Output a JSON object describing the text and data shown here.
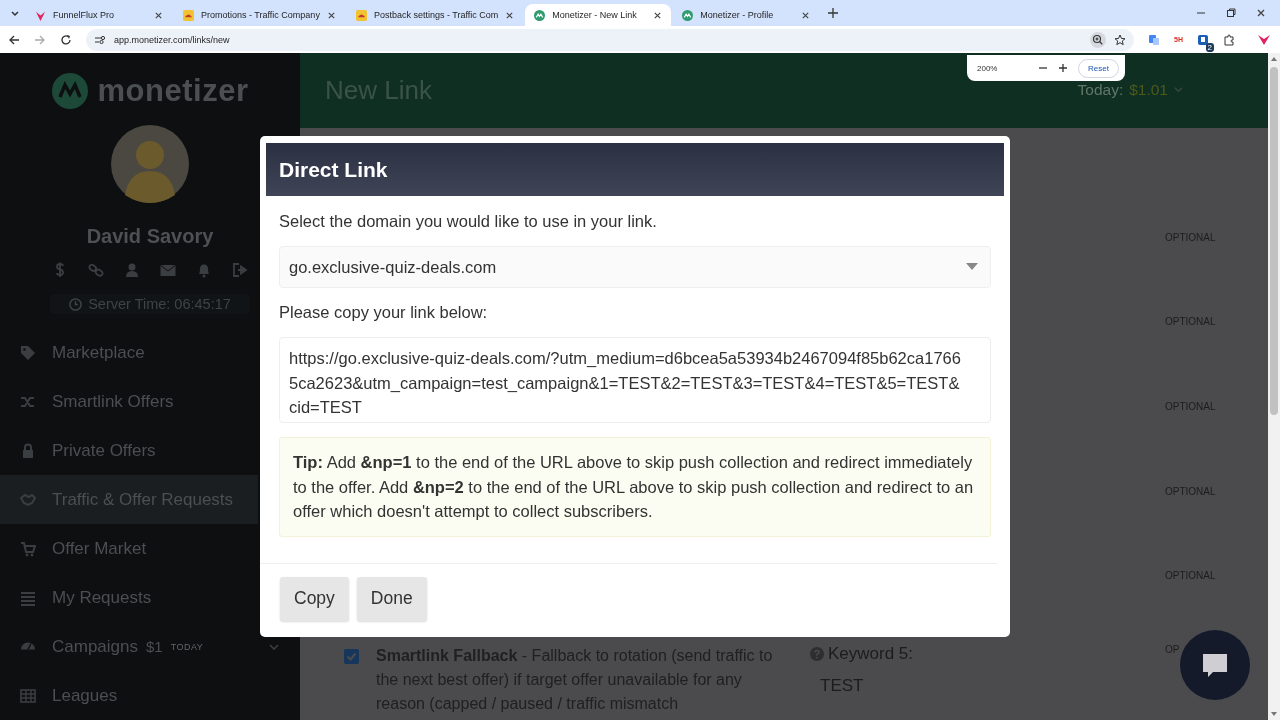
{
  "browser": {
    "tabs": [
      {
        "title": "FunnelFlux Pro",
        "selected": false
      },
      {
        "title": "Promotions - Traffic Company",
        "selected": false
      },
      {
        "title": "Postback settings - Traffic Com",
        "selected": false
      },
      {
        "title": "Monetizer - New Link",
        "selected": true
      },
      {
        "title": "Monetizer - Profile",
        "selected": false
      }
    ],
    "url": "app.monetizer.com/links/new",
    "extension_label": "5H",
    "extension_badge": "2"
  },
  "zoom_popup": {
    "zoom": "200%",
    "reset": "Reset"
  },
  "sidebar": {
    "brand": "monetizer",
    "user": "David Savory",
    "server_time": "Server Time: 06:45:17",
    "items": [
      {
        "label": "Marketplace",
        "selected": false
      },
      {
        "label": "Smartlink Offers",
        "selected": false
      },
      {
        "label": "Private Offers",
        "selected": false
      },
      {
        "label": "Traffic & Offer Requests",
        "selected": true
      },
      {
        "label": "Offer Market",
        "selected": false
      },
      {
        "label": "My Requests",
        "selected": false
      },
      {
        "label": "Campaigns",
        "selected": false,
        "amount": "$1",
        "badge": "TODAY",
        "expandable": true
      },
      {
        "label": "Leagues",
        "selected": false
      }
    ]
  },
  "header": {
    "title": "New Link",
    "today_label": "Today:",
    "today_value": "$1.01"
  },
  "background": {
    "optional_labels": [
      "OPTIONAL",
      "OPTIONAL",
      "OPTIONAL",
      "OPTIONAL",
      "OPTIONAL",
      "OP"
    ],
    "fallback": {
      "checked": true,
      "text": "**Smartlink Fallback** - Fallback to rotation (send traffic to the next best offer) if target offer unavailable for any reason (capped / paused / traffic mismatch"
    },
    "keyword": {
      "label": "Keyword 5:",
      "value": "TEST"
    }
  },
  "modal": {
    "title": "Direct Link",
    "domain_prompt": "Select the domain you would like to use in your link.",
    "domain": "go.exclusive-quiz-deals.com",
    "link_prompt": "Please copy your link below:",
    "link": "https://go.exclusive-quiz-deals.com/?utm_medium=d6bcea5a53934b2467094f85b62ca17665ca2623&utm_campaign=test_campaign&1=TEST&2=TEST&3=TEST&4=TEST&5=TEST&cid=TEST",
    "tip": "**Tip:** Add **&np=1** to the end of the URL above to skip push collection and redirect immediately to the offer. Add **&np=2** to the end of the URL above to skip push collection and redirect to an offer which doesn't attempt to collect subscribers.",
    "buttons": [
      "Copy",
      "Done"
    ]
  }
}
